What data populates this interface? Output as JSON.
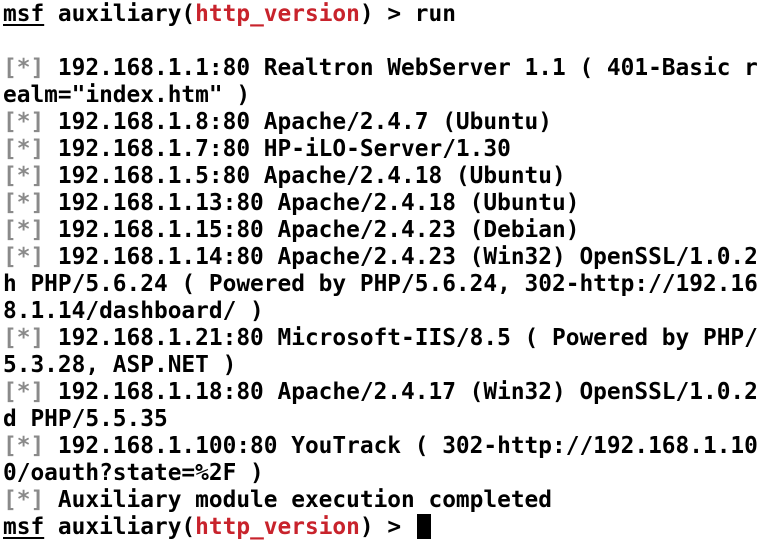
{
  "colors": {
    "background": "#ffffff",
    "text": "#000000",
    "module_name": "#c8232c",
    "status_marker": "#8a8a8a",
    "cursor": "#000000"
  },
  "prompt": {
    "msf": "msf",
    "context_open": " auxiliary(",
    "module": "http_version",
    "context_close": ")",
    "arrow": " > "
  },
  "command": "run",
  "status_marker": "[*]",
  "output_lines": [
    {
      "marker": true,
      "text": " 192.168.1.1:80 Realtron WebServer 1.1 ( 401-Basic r"
    },
    {
      "marker": false,
      "text": "ealm=\"index.htm\" )"
    },
    {
      "marker": true,
      "text": " 192.168.1.8:80 Apache/2.4.7 (Ubuntu)"
    },
    {
      "marker": true,
      "text": " 192.168.1.7:80 HP-iLO-Server/1.30"
    },
    {
      "marker": true,
      "text": " 192.168.1.5:80 Apache/2.4.18 (Ubuntu)"
    },
    {
      "marker": true,
      "text": " 192.168.1.13:80 Apache/2.4.18 (Ubuntu)"
    },
    {
      "marker": true,
      "text": " 192.168.1.15:80 Apache/2.4.23 (Debian)"
    },
    {
      "marker": true,
      "text": " 192.168.1.14:80 Apache/2.4.23 (Win32) OpenSSL/1.0.2"
    },
    {
      "marker": false,
      "text": "h PHP/5.6.24 ( Powered by PHP/5.6.24, 302-http://192.16"
    },
    {
      "marker": false,
      "text": "8.1.14/dashboard/ )"
    },
    {
      "marker": true,
      "text": " 192.168.1.21:80 Microsoft-IIS/8.5 ( Powered by PHP/"
    },
    {
      "marker": false,
      "text": "5.3.28, ASP.NET )"
    },
    {
      "marker": true,
      "text": " 192.168.1.18:80 Apache/2.4.17 (Win32) OpenSSL/1.0.2"
    },
    {
      "marker": false,
      "text": "d PHP/5.5.35"
    },
    {
      "marker": true,
      "text": " 192.168.1.100:80 YouTrack ( 302-http://192.168.1.10"
    },
    {
      "marker": false,
      "text": "0/oauth?state=%2F )"
    },
    {
      "marker": true,
      "text": " Auxiliary module execution completed"
    }
  ],
  "current_input": ""
}
